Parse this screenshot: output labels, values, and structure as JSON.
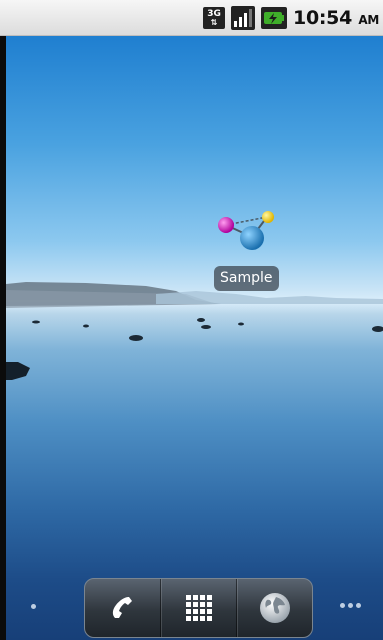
{
  "status_bar": {
    "network_type": "3G",
    "network_arrows": "⇅",
    "time": "10:54",
    "ampm": "AM",
    "icons": [
      "3g-data-icon",
      "signal-strength-icon",
      "battery-charging-icon"
    ]
  },
  "home": {
    "widget_label": "Sample",
    "widget_icon": "molecule-icon"
  },
  "dock": {
    "buttons": [
      "phone-icon",
      "app-drawer-icon",
      "browser-icon"
    ]
  },
  "colors": {
    "status_bar": "#e8e8e8",
    "battery_green": "#3fae2a",
    "sky_top": "#1f7fd0",
    "water_bottom": "#173f78"
  }
}
